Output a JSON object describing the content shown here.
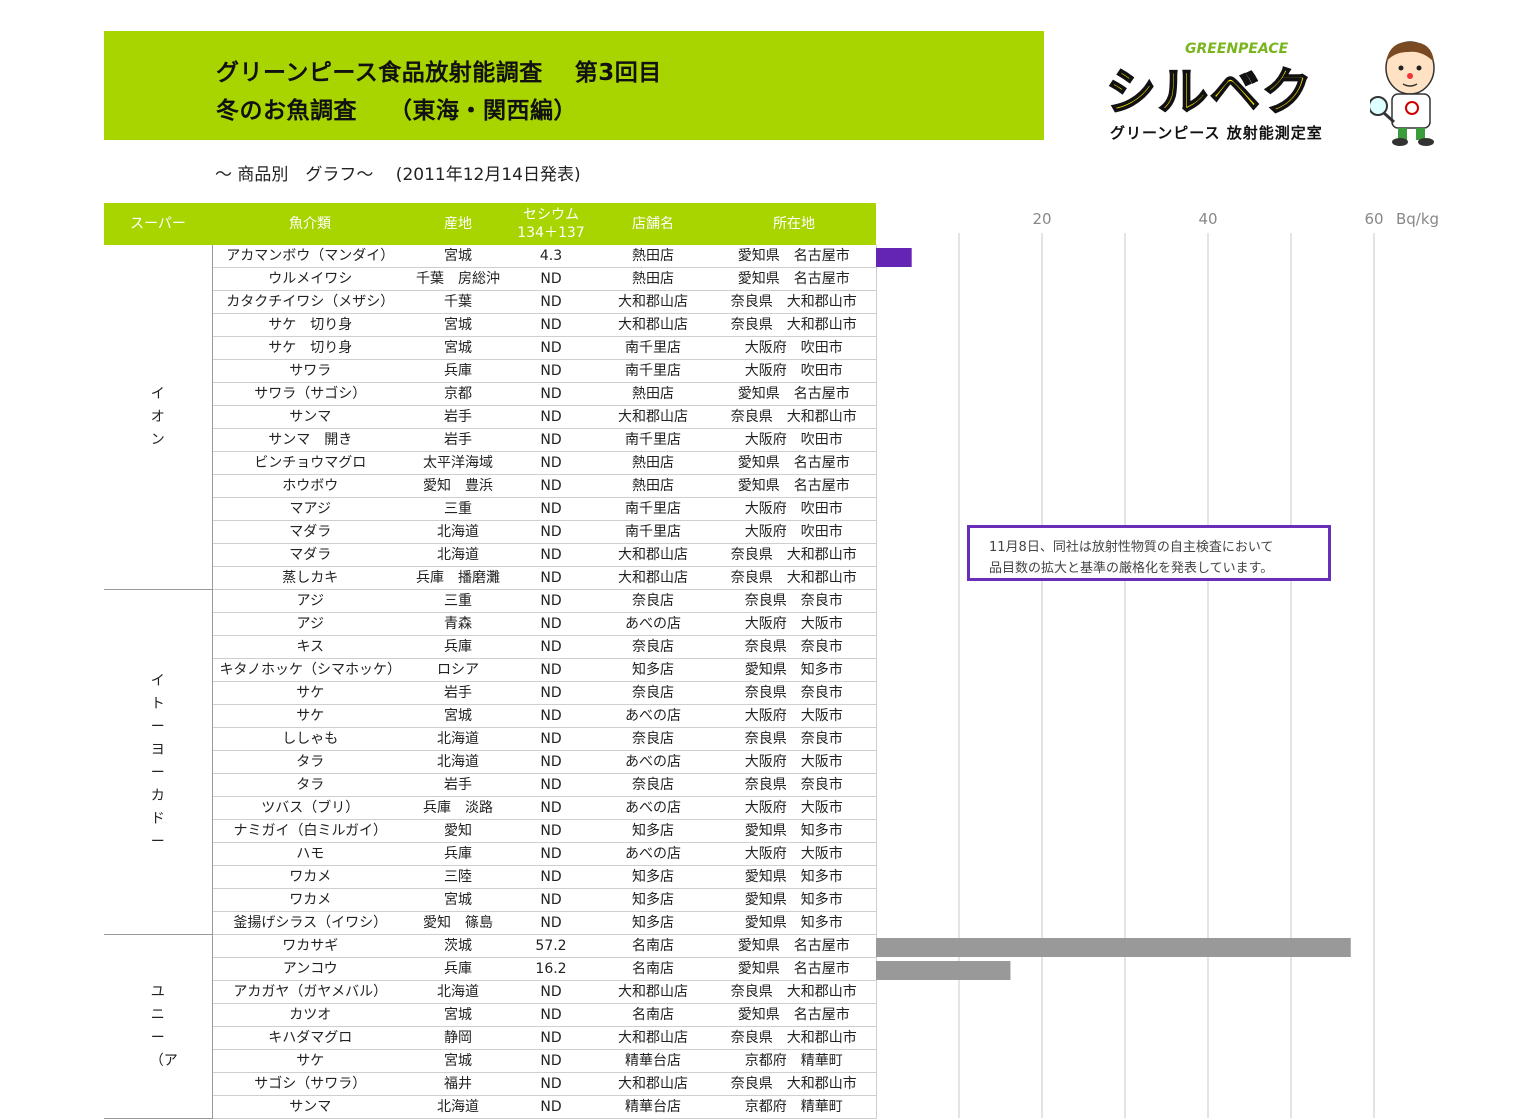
{
  "header": {
    "title_line1": "グリーンピース食品放射能調査　 第3回目",
    "title_line2": "冬のお魚調査　 （東海・関西編）",
    "subtitle": "〜 商品別　グラフ〜　 (2011年12月14日発表)"
  },
  "logo": {
    "org": "GREENPEACE",
    "brand": "シルベク",
    "caption": "グリーンピース 放射能測定室"
  },
  "table": {
    "columns": [
      "スーパー",
      "魚介類",
      "産地",
      "セシウム",
      "134＋137",
      "店舗名",
      "所在地"
    ],
    "groups": [
      {
        "super": "イオン",
        "rows": [
          {
            "fish": "アカマンボウ（マンダイ）",
            "origin": "宮城",
            "cs": "4.3",
            "store": "熱田店",
            "loc": "愛知県　名古屋市"
          },
          {
            "fish": "ウルメイワシ",
            "origin": "千葉　房総沖",
            "cs": "ND",
            "store": "熱田店",
            "loc": "愛知県　名古屋市"
          },
          {
            "fish": "カタクチイワシ（メザシ）",
            "origin": "千葉",
            "cs": "ND",
            "store": "大和郡山店",
            "loc": "奈良県　大和郡山市"
          },
          {
            "fish": "サケ　切り身",
            "origin": "宮城",
            "cs": "ND",
            "store": "大和郡山店",
            "loc": "奈良県　大和郡山市"
          },
          {
            "fish": "サケ　切り身",
            "origin": "宮城",
            "cs": "ND",
            "store": "南千里店",
            "loc": "大阪府　吹田市"
          },
          {
            "fish": "サワラ",
            "origin": "兵庫",
            "cs": "ND",
            "store": "南千里店",
            "loc": "大阪府　吹田市"
          },
          {
            "fish": "サワラ（サゴシ）",
            "origin": "京都",
            "cs": "ND",
            "store": "熱田店",
            "loc": "愛知県　名古屋市"
          },
          {
            "fish": "サンマ",
            "origin": "岩手",
            "cs": "ND",
            "store": "大和郡山店",
            "loc": "奈良県　大和郡山市"
          },
          {
            "fish": "サンマ　開き",
            "origin": "岩手",
            "cs": "ND",
            "store": "南千里店",
            "loc": "大阪府　吹田市"
          },
          {
            "fish": "ビンチョウマグロ",
            "origin": "太平洋海域",
            "cs": "ND",
            "store": "熱田店",
            "loc": "愛知県　名古屋市"
          },
          {
            "fish": "ホウボウ",
            "origin": "愛知　豊浜",
            "cs": "ND",
            "store": "熱田店",
            "loc": "愛知県　名古屋市"
          },
          {
            "fish": "マアジ",
            "origin": "三重",
            "cs": "ND",
            "store": "南千里店",
            "loc": "大阪府　吹田市"
          },
          {
            "fish": "マダラ",
            "origin": "北海道",
            "cs": "ND",
            "store": "南千里店",
            "loc": "大阪府　吹田市"
          },
          {
            "fish": "マダラ",
            "origin": "北海道",
            "cs": "ND",
            "store": "大和郡山店",
            "loc": "奈良県　大和郡山市"
          },
          {
            "fish": "蒸しカキ",
            "origin": "兵庫　播磨灘",
            "cs": "ND",
            "store": "大和郡山店",
            "loc": "奈良県　大和郡山市"
          }
        ]
      },
      {
        "super": "イトーヨーカドー",
        "rows": [
          {
            "fish": "アジ",
            "origin": "三重",
            "cs": "ND",
            "store": "奈良店",
            "loc": "奈良県　奈良市"
          },
          {
            "fish": "アジ",
            "origin": "青森",
            "cs": "ND",
            "store": "あべの店",
            "loc": "大阪府　大阪市"
          },
          {
            "fish": "キス",
            "origin": "兵庫",
            "cs": "ND",
            "store": "奈良店",
            "loc": "奈良県　奈良市"
          },
          {
            "fish": "キタノホッケ（シマホッケ）",
            "origin": "ロシア",
            "cs": "ND",
            "store": "知多店",
            "loc": "愛知県　知多市"
          },
          {
            "fish": "サケ",
            "origin": "岩手",
            "cs": "ND",
            "store": "奈良店",
            "loc": "奈良県　奈良市"
          },
          {
            "fish": "サケ",
            "origin": "宮城",
            "cs": "ND",
            "store": "あべの店",
            "loc": "大阪府　大阪市"
          },
          {
            "fish": "ししゃも",
            "origin": "北海道",
            "cs": "ND",
            "store": "奈良店",
            "loc": "奈良県　奈良市"
          },
          {
            "fish": "タラ",
            "origin": "北海道",
            "cs": "ND",
            "store": "あべの店",
            "loc": "大阪府　大阪市"
          },
          {
            "fish": "タラ",
            "origin": "岩手",
            "cs": "ND",
            "store": "奈良店",
            "loc": "奈良県　奈良市"
          },
          {
            "fish": "ツバス（ブリ）",
            "origin": "兵庫　淡路",
            "cs": "ND",
            "store": "あべの店",
            "loc": "大阪府　大阪市"
          },
          {
            "fish": "ナミガイ（白ミルガイ）",
            "origin": "愛知",
            "cs": "ND",
            "store": "知多店",
            "loc": "愛知県　知多市"
          },
          {
            "fish": "ハモ",
            "origin": "兵庫",
            "cs": "ND",
            "store": "あべの店",
            "loc": "大阪府　大阪市"
          },
          {
            "fish": "ワカメ",
            "origin": "三陸",
            "cs": "ND",
            "store": "知多店",
            "loc": "愛知県　知多市"
          },
          {
            "fish": "ワカメ",
            "origin": "宮城",
            "cs": "ND",
            "store": "知多店",
            "loc": "愛知県　知多市"
          },
          {
            "fish": "釜揚げシラス（イワシ）",
            "origin": "愛知　篠島",
            "cs": "ND",
            "store": "知多店",
            "loc": "愛知県　知多市"
          }
        ]
      },
      {
        "super": "ユニー（ア",
        "rows": [
          {
            "fish": "ワカサギ",
            "origin": "茨城",
            "cs": "57.2",
            "store": "名南店",
            "loc": "愛知県　名古屋市"
          },
          {
            "fish": "アンコウ",
            "origin": "兵庫",
            "cs": "16.2",
            "store": "名南店",
            "loc": "愛知県　名古屋市"
          },
          {
            "fish": "アカガヤ（ガヤメバル）",
            "origin": "北海道",
            "cs": "ND",
            "store": "大和郡山店",
            "loc": "奈良県　大和郡山市"
          },
          {
            "fish": "カツオ",
            "origin": "宮城",
            "cs": "ND",
            "store": "名南店",
            "loc": "愛知県　名古屋市"
          },
          {
            "fish": "キハダマグロ",
            "origin": "静岡",
            "cs": "ND",
            "store": "大和郡山店",
            "loc": "奈良県　大和郡山市"
          },
          {
            "fish": "サケ",
            "origin": "宮城",
            "cs": "ND",
            "store": "精華台店",
            "loc": "京都府　精華町"
          },
          {
            "fish": "サゴシ（サワラ）",
            "origin": "福井",
            "cs": "ND",
            "store": "大和郡山店",
            "loc": "奈良県　大和郡山市"
          },
          {
            "fish": "サンマ",
            "origin": "北海道",
            "cs": "ND",
            "store": "精華台店",
            "loc": "京都府　精華町"
          }
        ]
      }
    ]
  },
  "chart_data": {
    "type": "bar",
    "orientation": "horizontal",
    "unit_label": "Bq/kg",
    "xlim": [
      0,
      60
    ],
    "ticks": [
      "20",
      "40",
      "60"
    ],
    "grid": true,
    "bars": [
      {
        "row": 0,
        "value": 4.3,
        "color": "#6424b4"
      },
      {
        "row": 30,
        "value": 57.2,
        "color": "#999999"
      },
      {
        "row": 31,
        "value": 16.2,
        "color": "#999999"
      }
    ]
  },
  "note": {
    "line1": "11月8日、同社は放射性物質の自主検査において",
    "line2": "品目数の拡大と基準の厳格化を発表しています。"
  }
}
